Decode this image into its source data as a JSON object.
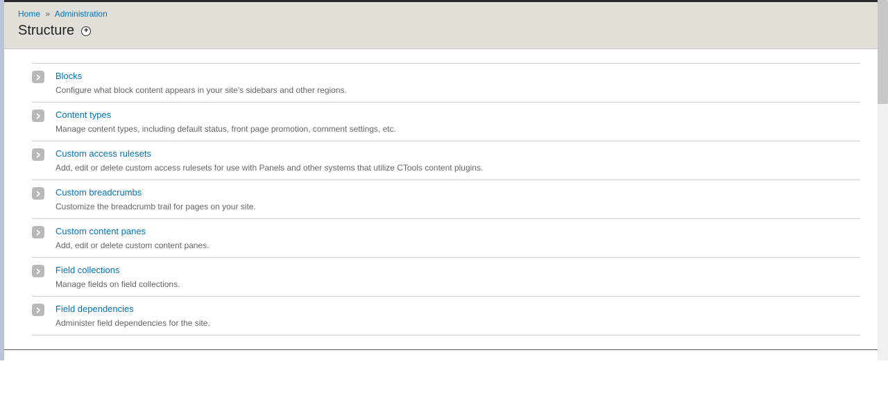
{
  "breadcrumb": {
    "home": "Home",
    "sep": "»",
    "admin": "Administration"
  },
  "page": {
    "title": "Structure"
  },
  "items": [
    {
      "title": "Blocks",
      "desc": "Configure what block content appears in your site's sidebars and other regions."
    },
    {
      "title": "Content types",
      "desc": "Manage content types, including default status, front page promotion, comment settings, etc."
    },
    {
      "title": "Custom access rulesets",
      "desc": "Add, edit or delete custom access rulesets for use with Panels and other systems that utilize CTools content plugins."
    },
    {
      "title": "Custom breadcrumbs",
      "desc": "Customize the breadcrumb trail for pages on your site."
    },
    {
      "title": "Custom content panes",
      "desc": "Add, edit or delete custom content panes."
    },
    {
      "title": "Field collections",
      "desc": "Manage fields on field collections."
    },
    {
      "title": "Field dependencies",
      "desc": "Administer field dependencies for the site."
    }
  ]
}
